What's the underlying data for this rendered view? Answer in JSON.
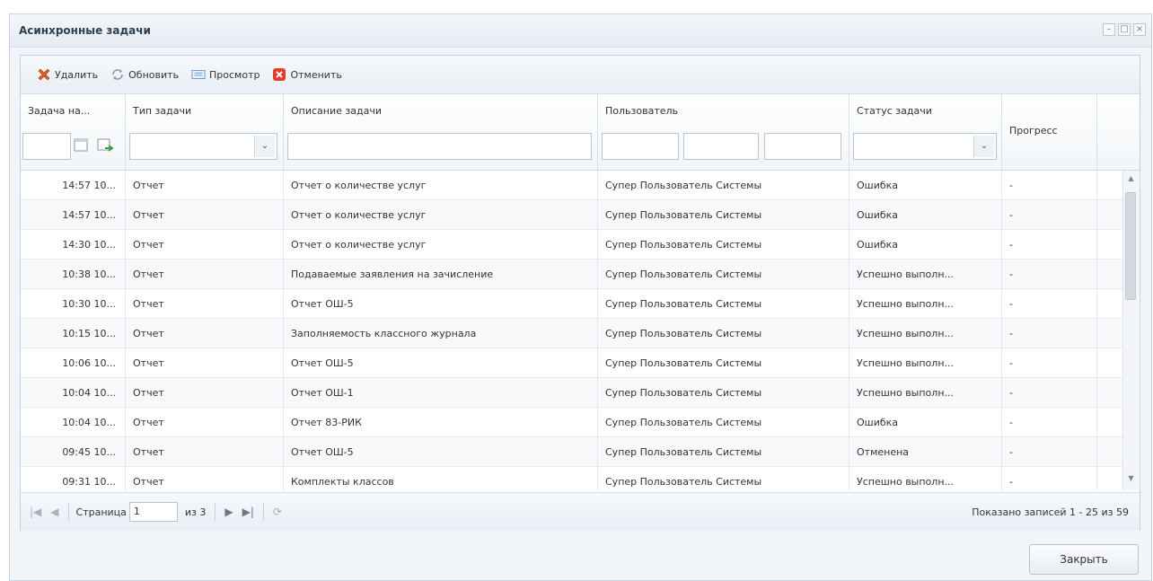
{
  "window": {
    "title": "Асинхронные задачи",
    "controls": [
      "–",
      "□",
      "×"
    ]
  },
  "toolbar": {
    "delete_label": "Удалить",
    "refresh_label": "Обновить",
    "view_label": "Просмотр",
    "cancel_label": "Отменить"
  },
  "columns": {
    "start": "Задача на...",
    "type": "Тип задачи",
    "description": "Описание задачи",
    "user": "Пользователь",
    "status": "Статус задачи",
    "progress": "Прогресс"
  },
  "combo_arrow": "⌄",
  "rows": [
    {
      "time": "14:57 10...",
      "type": "Отчет",
      "description": "Отчет о количестве услуг",
      "user": "Супер Пользователь Системы",
      "status": "Ошибка",
      "progress": "-"
    },
    {
      "time": "14:57 10...",
      "type": "Отчет",
      "description": "Отчет о количестве услуг",
      "user": "Супер Пользователь Системы",
      "status": "Ошибка",
      "progress": "-"
    },
    {
      "time": "14:30 10...",
      "type": "Отчет",
      "description": "Отчет о количестве услуг",
      "user": "Супер Пользователь Системы",
      "status": "Ошибка",
      "progress": "-"
    },
    {
      "time": "10:38 10...",
      "type": "Отчет",
      "description": "Подаваемые заявления на зачисление",
      "user": "Супер Пользователь Системы",
      "status": "Успешно выполн...",
      "progress": "-"
    },
    {
      "time": "10:30 10...",
      "type": "Отчет",
      "description": "Отчет ОШ-5",
      "user": "Супер Пользователь Системы",
      "status": "Успешно выполн...",
      "progress": "-"
    },
    {
      "time": "10:15 10...",
      "type": "Отчет",
      "description": "Заполняемость классного журнала",
      "user": "Супер Пользователь Системы",
      "status": "Успешно выполн...",
      "progress": "-"
    },
    {
      "time": "10:06 10...",
      "type": "Отчет",
      "description": "Отчет ОШ-5",
      "user": "Супер Пользователь Системы",
      "status": "Успешно выполн...",
      "progress": "-"
    },
    {
      "time": "10:04 10...",
      "type": "Отчет",
      "description": "Отчет ОШ-1",
      "user": "Супер Пользователь Системы",
      "status": "Успешно выполн...",
      "progress": "-"
    },
    {
      "time": "10:04 10...",
      "type": "Отчет",
      "description": "Отчет 83-РИК",
      "user": "Супер Пользователь Системы",
      "status": "Ошибка",
      "progress": "-"
    },
    {
      "time": "09:45 10...",
      "type": "Отчет",
      "description": "Отчет ОШ-5",
      "user": "Супер Пользователь Системы",
      "status": "Отменена",
      "progress": "-"
    },
    {
      "time": "09:31 10...",
      "type": "Отчет",
      "description": "Комплекты классов",
      "user": "Супер Пользователь Системы",
      "status": "Успешно выполн...",
      "progress": "-"
    }
  ],
  "pager": {
    "page_label": "Страница",
    "page_value": "1",
    "of_label": "из 3",
    "status": "Показано записей 1 - 25 из 59"
  },
  "footer": {
    "close_label": "Закрыть"
  }
}
